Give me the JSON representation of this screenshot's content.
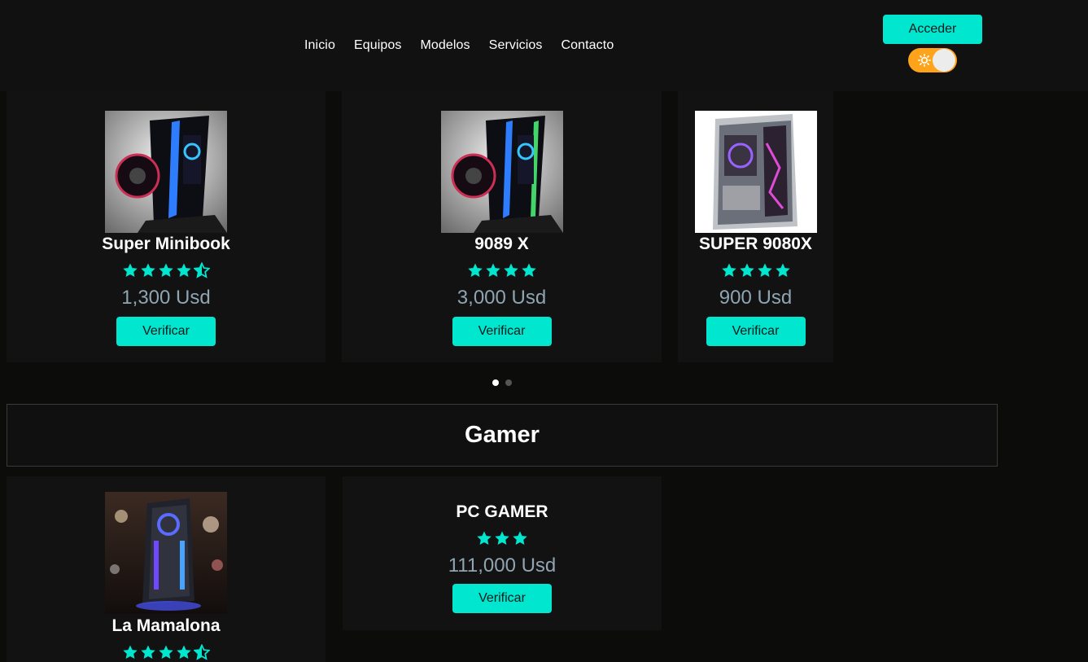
{
  "nav": {
    "items": [
      "Inicio",
      "Equipos",
      "Modelos",
      "Servicios",
      "Contacto"
    ]
  },
  "header": {
    "login_label": "Acceder",
    "theme_toggle": {
      "icon": "sun-icon",
      "state": "on",
      "color": "#ffa31a"
    }
  },
  "colors": {
    "accent": "#00e6cf",
    "price": "#8fa5b2",
    "background": "#0c0c0b",
    "card": "#121212"
  },
  "carousel": {
    "active_index": 0,
    "total_dots": 2,
    "products": [
      {
        "name": "Super Minibook",
        "rating": 4.5,
        "price": "1,300 Usd",
        "action": "Verificar",
        "image": "pc-case-rgb-image"
      },
      {
        "name": "9089 X",
        "rating": 4,
        "price": "3,000 Usd",
        "action": "Verificar",
        "image": "pc-case-rgb-image"
      },
      {
        "name": "SUPER 9080X",
        "rating": 4,
        "price": "900 Usd",
        "action": "Verificar",
        "image": "pc-case-white-image"
      }
    ]
  },
  "gamer_section": {
    "title": "Gamer",
    "products": [
      {
        "name": "La Mamalona",
        "rating": 4.5,
        "image": "gaming-tower-image"
      },
      {
        "name": "PC GAMER",
        "rating": 3,
        "price": "111,000 Usd",
        "action": "Verificar"
      }
    ]
  }
}
